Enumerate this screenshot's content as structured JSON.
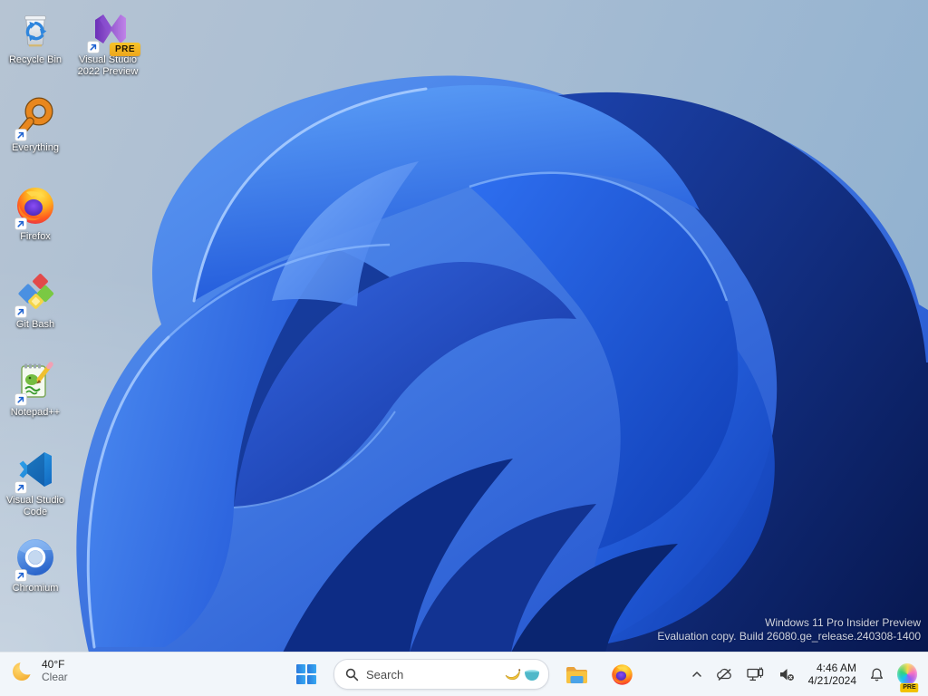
{
  "desktop": {
    "icons": [
      {
        "id": "recycle-bin",
        "label": "Recycle Bin",
        "shortcut": false
      },
      {
        "id": "visual-studio-2022-preview",
        "label": "Visual Studio 2022 Preview",
        "shortcut": true,
        "badge": "PRE"
      },
      {
        "id": "everything",
        "label": "Everything",
        "shortcut": true
      },
      {
        "id": "firefox",
        "label": "Firefox",
        "shortcut": true
      },
      {
        "id": "git-bash",
        "label": "Git Bash",
        "shortcut": true
      },
      {
        "id": "notepad-plus-plus",
        "label": "Notepad++",
        "shortcut": true
      },
      {
        "id": "visual-studio-code",
        "label": "Visual Studio Code",
        "shortcut": true
      },
      {
        "id": "chromium",
        "label": "Chromium",
        "shortcut": true
      }
    ],
    "watermark": {
      "line1": "Windows 11 Pro Insider Preview",
      "line2": "Evaluation copy. Build 26080.ge_release.240308-1400"
    }
  },
  "taskbar": {
    "weather": {
      "temperature": "40°F",
      "condition": "Clear",
      "icon": "crescent-moon"
    },
    "start": {
      "tooltip": "Start"
    },
    "search": {
      "placeholder": "Search",
      "highlight_icons": [
        "banana",
        "bowl"
      ]
    },
    "pinned": [
      {
        "icon": "file-explorer"
      },
      {
        "icon": "firefox"
      }
    ],
    "tray": {
      "chevron": "show-hidden-icons",
      "icons": [
        "onedrive-paused",
        "wired-network",
        "volume-muted"
      ],
      "time": "4:46 AM",
      "date": "4/21/2024",
      "bell": "notifications",
      "copilot_badge": "PRE"
    }
  },
  "colors": {
    "taskbar_bg": "#f2f6fa",
    "bloom_bright": "#2e6ff0",
    "bloom_dark": "#0a2168",
    "background_steel_blue": "#8cafcf",
    "badge_amber": "#f2b824",
    "accent_blue": "#2f86dd"
  }
}
